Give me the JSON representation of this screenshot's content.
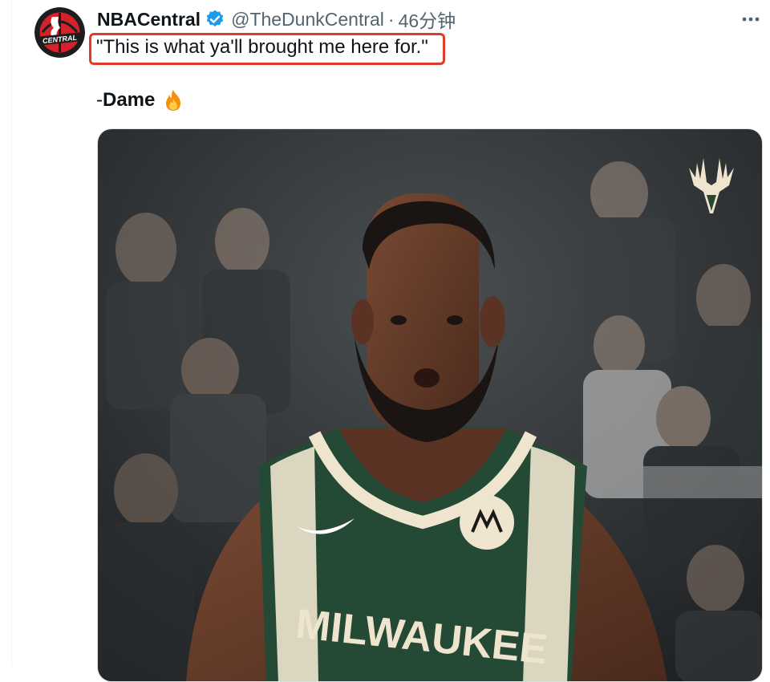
{
  "tweet": {
    "display_name": "NBACentral",
    "handle": "@TheDunkCentral",
    "separator": "·",
    "time": "46分钟",
    "text_line1": "\"This is what ya'll brought me here for.\"",
    "signature_dash": "- ",
    "signature_name": "Dame",
    "emoji": "fire-emoji",
    "verified": true,
    "avatar": {
      "icon": "nba-central-logo",
      "wordmark": "CENTRAL",
      "colors": {
        "ring": "#1d1d1f",
        "red": "#d4222b",
        "white": "#ffffff"
      }
    },
    "more_icon": "more-horizontal-icon"
  },
  "media": {
    "type": "video-still",
    "team_logo_icon": "bucks-logo",
    "jersey_text": "MILWAUKEE",
    "colors": {
      "jersey": "#244a35",
      "trim": "#efe5cf",
      "crowd": "#2b2e30"
    }
  },
  "accent": {
    "highlight_box": "#e03a2b",
    "verified_blue": "#1d9bf0"
  }
}
